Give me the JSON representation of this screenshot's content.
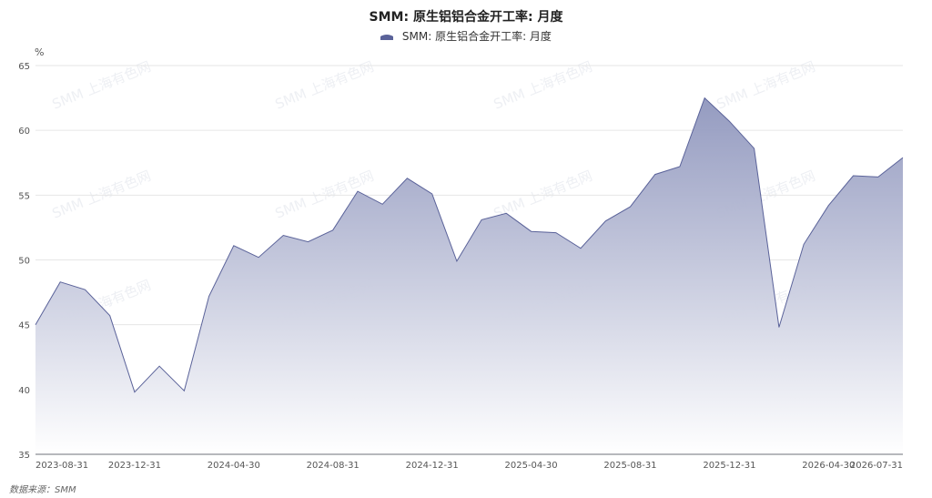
{
  "chart_data": {
    "type": "area",
    "title": "SMM: 原生铝铝合金开工率: 月度",
    "ylabel": "%",
    "ylim": [
      35,
      65
    ],
    "yticks": [
      35,
      40,
      45,
      50,
      55,
      60,
      65
    ],
    "grid": true,
    "legend_position": "top",
    "x": [
      "2023-08-31",
      "2023-09-30",
      "2023-10-31",
      "2023-11-30",
      "2023-12-31",
      "2024-01-31",
      "2024-02-29",
      "2024-03-31",
      "2024-04-30",
      "2024-05-31",
      "2024-06-30",
      "2024-07-31",
      "2024-08-31",
      "2024-09-30",
      "2024-10-31",
      "2024-11-30",
      "2024-12-31",
      "2025-01-31",
      "2025-02-28",
      "2025-03-31",
      "2025-04-30",
      "2025-05-31",
      "2025-06-30",
      "2025-07-31",
      "2025-08-31",
      "2025-09-30",
      "2025-10-31",
      "2025-11-30",
      "2025-12-31",
      "2026-01-31",
      "2026-02-28",
      "2026-03-31",
      "2026-04-30",
      "2026-05-31",
      "2026-06-30",
      "2026-07-31"
    ],
    "x_tick_labels": [
      "2023-08-31",
      "2023-12-31",
      "2024-04-30",
      "2024-08-31",
      "2024-12-31",
      "2025-04-30",
      "2025-08-31",
      "2025-12-31",
      "2026-04-30",
      "2026-07-31"
    ],
    "series": [
      {
        "name": "SMM: 原生铝合金开工率: 月度",
        "color": "#5a6299",
        "values": [
          45.0,
          48.3,
          47.7,
          45.7,
          39.8,
          41.8,
          39.9,
          47.2,
          51.1,
          50.2,
          51.9,
          51.4,
          52.3,
          55.3,
          54.3,
          56.3,
          55.1,
          49.9,
          53.1,
          53.6,
          52.2,
          52.1,
          50.9,
          53.0,
          54.1,
          56.6,
          57.2,
          62.5,
          60.7,
          58.6,
          44.8,
          51.2,
          54.2,
          56.5,
          56.4,
          57.9
        ]
      }
    ]
  },
  "watermark_text": "SMM 上海有色网",
  "source_text": "数据来源：SMM"
}
